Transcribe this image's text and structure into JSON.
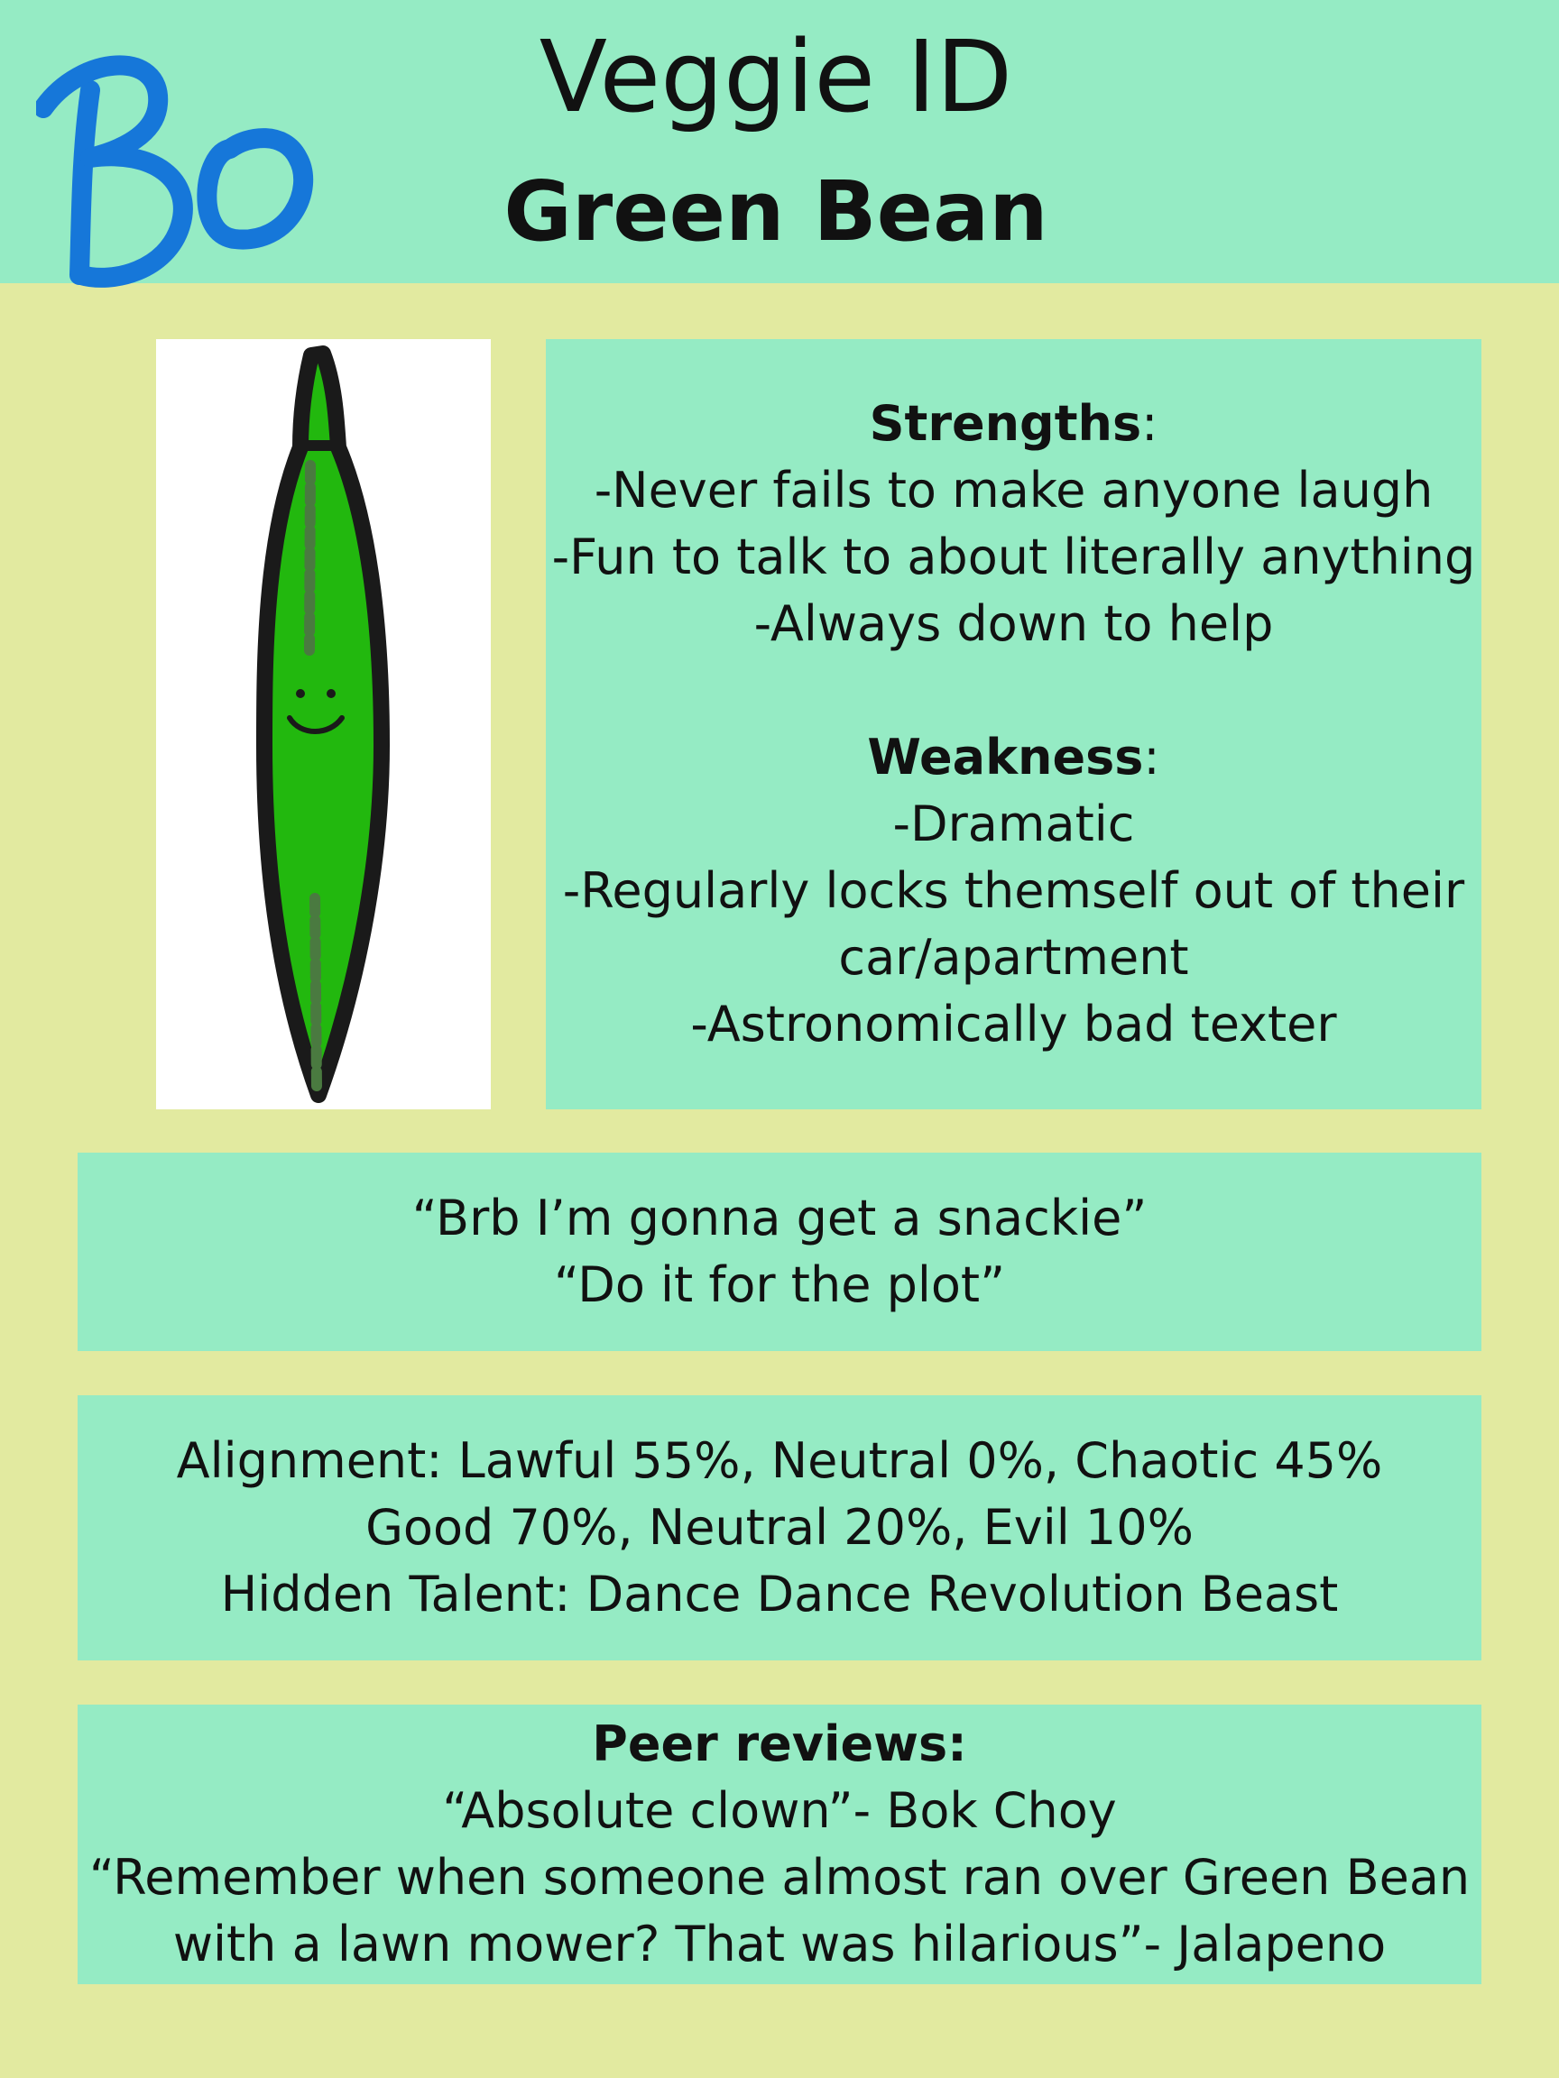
{
  "header": {
    "title": "Veggie ID",
    "subtitle": "Green Bean",
    "logo_text": "BO",
    "logo_color": "#1677d9"
  },
  "colors": {
    "header_bg": "#95ebc4",
    "page_bg": "#e2eaa0",
    "panel_bg": "#95ebc4",
    "bean_green": "#22b80e"
  },
  "illustration": {
    "subject": "green-bean-character-icon"
  },
  "strengths": {
    "heading": "Strengths",
    "items": [
      "-Never fails to make anyone laugh",
      "-Fun to talk to about literally anything",
      "-Always down to help"
    ]
  },
  "weakness": {
    "heading": "Weakness",
    "items": [
      "-Dramatic",
      "-Regularly locks themself out of their",
      "car/apartment",
      "-Astronomically bad texter"
    ]
  },
  "quotes": [
    "“Brb I’m gonna get a snackie”",
    "“Do it for the plot”"
  ],
  "stats": [
    "Alignment: Lawful 55%, Neutral 0%, Chaotic 45%",
    "Good 70%, Neutral 20%, Evil 10%",
    "Hidden Talent: Dance Dance Revolution Beast"
  ],
  "reviews": {
    "heading": "Peer reviews:",
    "lines": [
      "“Absolute clown”- Bok Choy",
      "“Remember when someone almost ran over Green Bean",
      "with a lawn mower? That was hilarious”- Jalapeno"
    ]
  }
}
